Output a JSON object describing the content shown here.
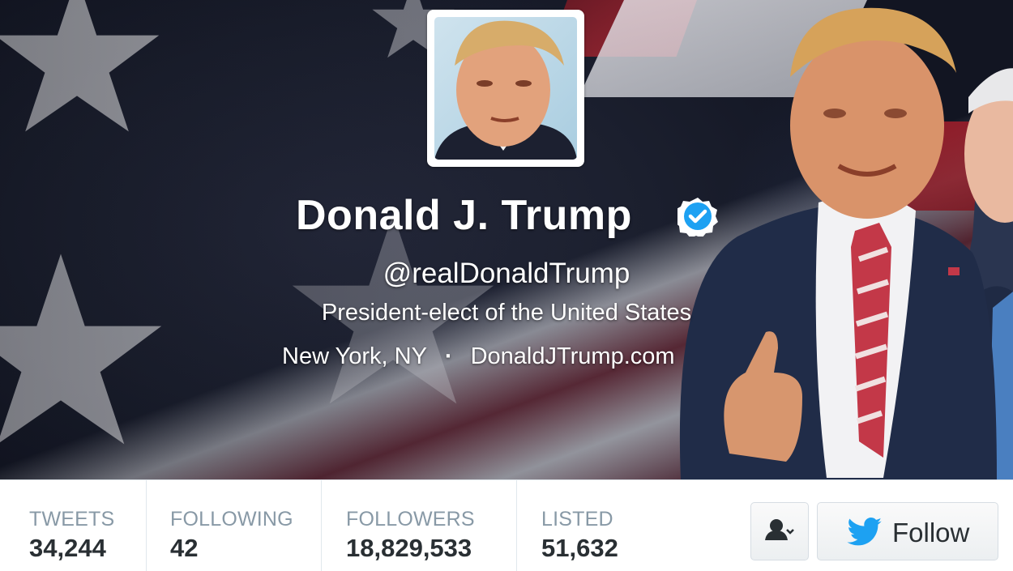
{
  "profile": {
    "name": "Donald J. Trump",
    "verified": true,
    "screen_name": "@realDonaldTrump",
    "bio": "President-elect of the United States",
    "location": "New York, NY",
    "separator": "·",
    "website": "DonaldJTrump.com"
  },
  "stats": [
    {
      "label": "TWEETS",
      "value": "34,244"
    },
    {
      "label": "FOLLOWING",
      "value": "42"
    },
    {
      "label": "FOLLOWERS",
      "value": "18,829,533"
    },
    {
      "label": "LISTED",
      "value": "51,632"
    }
  ],
  "actions": {
    "user_menu_icon": "person-dropdown-icon",
    "follow_label": "Follow",
    "follow_icon": "twitter-bird-icon"
  },
  "colors": {
    "verified_blue": "#1da1f2",
    "twitter_blue": "#1da1f2",
    "stat_label": "#8899a6",
    "stat_value": "#292f33"
  }
}
